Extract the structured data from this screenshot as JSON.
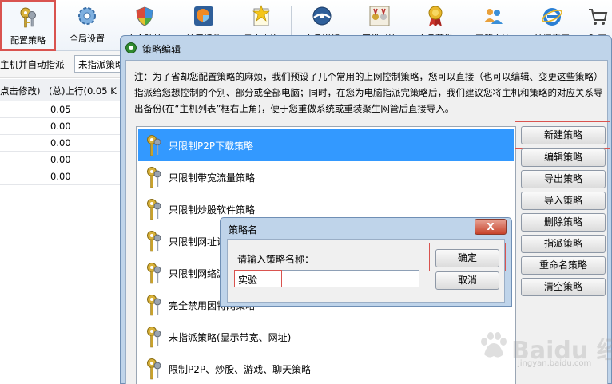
{
  "toolbar": {
    "items": [
      {
        "label": "配置策略",
        "icon": "keys-icon"
      },
      {
        "label": "全局设置",
        "icon": "gear-icon"
      },
      {
        "label": "安全防护",
        "icon": "shield-icon"
      },
      {
        "label": "扩展插件",
        "icon": "plugin-icon"
      },
      {
        "label": "日志查询",
        "icon": "star-note-icon"
      },
      {
        "label": "产品详解",
        "icon": "globe-icon"
      },
      {
        "label": "同类对比",
        "icon": "medals-icon"
      },
      {
        "label": "产品荣誉",
        "icon": "award-icon"
      },
      {
        "label": "网管交流",
        "icon": "users-icon"
      },
      {
        "label": "访问官网",
        "icon": "ie-icon"
      },
      {
        "label": "购买",
        "icon": "cart-icon"
      }
    ]
  },
  "main": {
    "filter_label": "主机并自动指派",
    "filter_value": "未指派策略",
    "grid_headers": [
      "点击修改)",
      "(总)上行(0.05 K"
    ],
    "grid_values": [
      "0.05",
      "0.00",
      "0.00",
      "0.00",
      "0.00"
    ]
  },
  "policy_window": {
    "title": "策略编辑",
    "note": "注：为了省却您配置策略的麻烦，我们预设了几个常用的上网控制策略，您可以直接（也可以编辑、变更这些策略）指派给您想控制的个别、部分或全部电脑；同时，在您为电脑指派完策略后，我们建议您将主机和策略的对应关系导出备份(在“主机列表”框右上角)，便于您重做系统或重装聚生网管后直接导入。",
    "policies": [
      "只限制P2P下载策略",
      "只限制带宽流量策略",
      "只限制炒股软件策略",
      "只限制网址访问策略",
      "只限制网络游戏策略",
      "完全禁用因特网策略",
      "未指派策略(显示带宽、网址)",
      "限制P2P、炒股、游戏、聊天策略"
    ],
    "buttons": [
      "新建策略",
      "编辑策略",
      "导出策略",
      "导入策略",
      "删除策略",
      "指派策略",
      "重命名策略",
      "清空策略"
    ]
  },
  "name_dialog": {
    "title": "策略名",
    "close_label": "X",
    "prompt": "请输入策略名称：",
    "input_value": "实验",
    "ok_label": "确定",
    "cancel_label": "取消"
  },
  "watermark": {
    "text": "Baidu 经验",
    "sub": "jingyan.baidu.com"
  },
  "colors": {
    "selection": "#3399ff",
    "highlight_box": "#d9534f",
    "window_frame": "#bfd4ea"
  }
}
